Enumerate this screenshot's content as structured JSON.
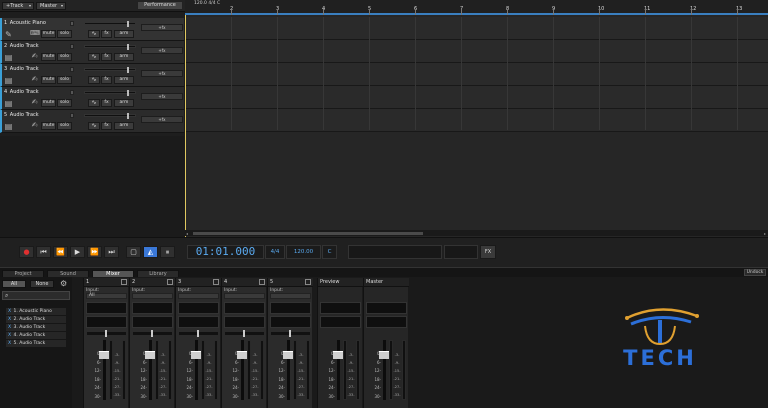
{
  "toolbar": {
    "track_menu": "+Track",
    "master_menu": "Master",
    "performance": "Performance"
  },
  "tracks": [
    {
      "num": "1",
      "name": "Acoustic Piano",
      "icon": "piano-icon",
      "tool_icon": "pencil-icon",
      "mute": "mute",
      "solo": "solo",
      "fx": "fx",
      "arm": "arm"
    },
    {
      "num": "2",
      "name": "Audio Track",
      "icon": "audio-track-icon",
      "tool_icon": "wrench-icon",
      "mute": "mute",
      "solo": "solo",
      "fx": "fx",
      "arm": "arm"
    },
    {
      "num": "3",
      "name": "Audio Track",
      "icon": "audio-track-icon",
      "tool_icon": "wrench-icon",
      "mute": "mute",
      "solo": "solo",
      "fx": "fx",
      "arm": "arm"
    },
    {
      "num": "4",
      "name": "Audio Track",
      "icon": "audio-track-icon",
      "tool_icon": "wrench-icon",
      "mute": "mute",
      "solo": "solo",
      "fx": "fx",
      "arm": "arm"
    },
    {
      "num": "5",
      "name": "Audio Track",
      "icon": "audio-track-icon",
      "tool_icon": "wrench-icon",
      "mute": "mute",
      "solo": "solo",
      "fx": "fx",
      "arm": "arm"
    }
  ],
  "track_add_fx": "+fx",
  "ruler": {
    "info": "120.0 4/4 C",
    "bars": [
      "2",
      "3",
      "4",
      "5",
      "6",
      "7",
      "8",
      "9",
      "10",
      "11",
      "12",
      "13"
    ]
  },
  "transport": {
    "timecode": "01:01.000",
    "signature": "4/4",
    "tempo": "120.00",
    "key": "C",
    "fx": "FX",
    "loop_active": true
  },
  "tabs": {
    "items": [
      "Project",
      "Sound",
      "Mixer",
      "Library"
    ],
    "active": "Mixer",
    "undock": "Undock"
  },
  "mixer": {
    "filter_all": "All",
    "filter_none": "None",
    "track_list": [
      {
        "mark": "X",
        "label": "1. Acoustic Piano"
      },
      {
        "mark": "X",
        "label": "2. Audio Track"
      },
      {
        "mark": "X",
        "label": "3. Audio Track"
      },
      {
        "mark": "X",
        "label": "4. Audio Track"
      },
      {
        "mark": "X",
        "label": "5. Audio Track"
      }
    ],
    "strips": [
      {
        "name": "1",
        "input_label": "Input:",
        "input_value": "All"
      },
      {
        "name": "2",
        "input_label": "Input:",
        "input_value": ""
      },
      {
        "name": "3",
        "input_label": "Input:",
        "input_value": ""
      },
      {
        "name": "4",
        "input_label": "Input:",
        "input_value": ""
      },
      {
        "name": "5",
        "input_label": "Input:",
        "input_value": ""
      }
    ],
    "buses": [
      {
        "name": "Preview"
      },
      {
        "name": "Master"
      }
    ],
    "fader_scale": [
      "0-",
      "6-",
      "12-",
      "18-",
      "24-",
      "30-"
    ],
    "meter_scale": [
      "-3-",
      "-9-",
      "-15-",
      "-21-",
      "-27-",
      "-33-"
    ]
  },
  "watermark": {
    "text": "TECH",
    "color": "#2c6fd8"
  },
  "colors": {
    "accent": "#3a7fc0",
    "timecode": "#5aaaf0",
    "record": "#e03030",
    "playhead": "#e0c860"
  }
}
